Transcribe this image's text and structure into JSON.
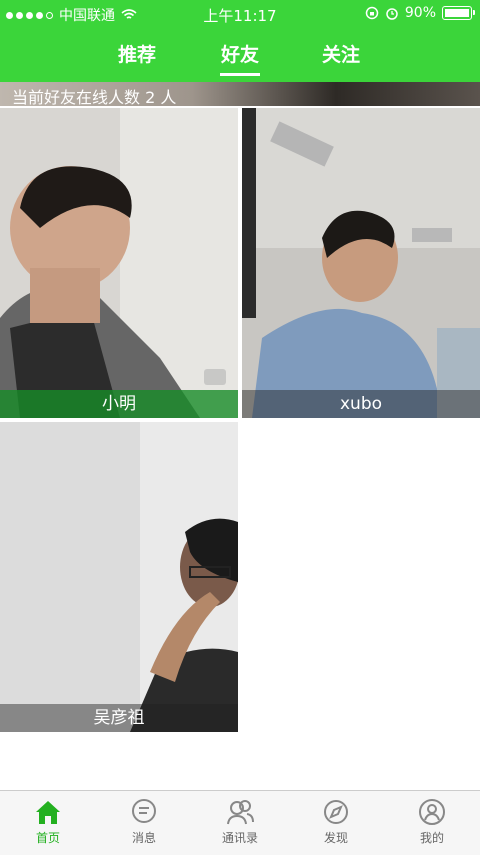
{
  "status_bar": {
    "carrier": "中国联通",
    "time": "上午11:17",
    "battery": "90%"
  },
  "tabs": [
    {
      "label": "推荐"
    },
    {
      "label": "好友"
    },
    {
      "label": "关注"
    }
  ],
  "online_count_text": "当前好友在线人数 2 人",
  "friends": [
    {
      "name": "小明"
    },
    {
      "name": "xubo"
    },
    {
      "name": "吴彦祖"
    }
  ],
  "bottom_nav": [
    {
      "label": "首页",
      "icon": "home-icon"
    },
    {
      "label": "消息",
      "icon": "message-icon"
    },
    {
      "label": "通讯录",
      "icon": "contacts-icon"
    },
    {
      "label": "发现",
      "icon": "discover-icon"
    },
    {
      "label": "我的",
      "icon": "profile-icon"
    }
  ],
  "colors": {
    "accent": "#3bd53a",
    "active_nav": "#23b020"
  }
}
